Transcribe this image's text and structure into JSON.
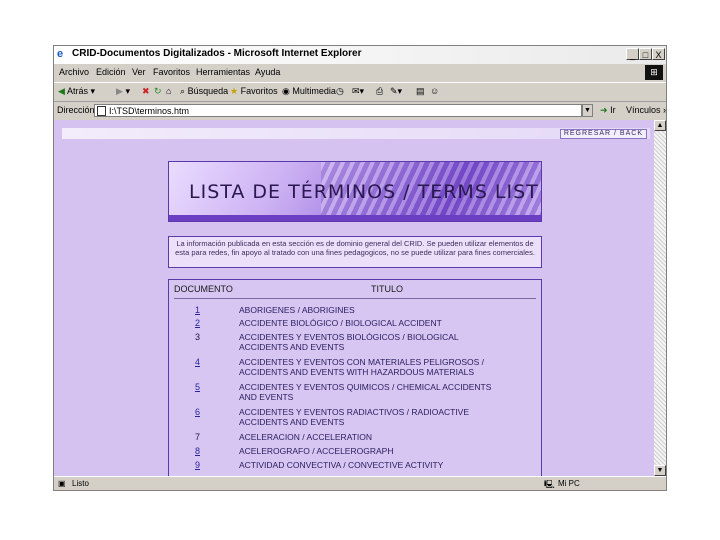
{
  "window": {
    "title": "CRID-Documentos Digitalizados - Microsoft Internet Explorer",
    "controls": [
      "_",
      "□",
      "X"
    ]
  },
  "menu": [
    "Archivo",
    "Edición",
    "Ver",
    "Favoritos",
    "Herramientas",
    "Ayuda"
  ],
  "toolbar": {
    "back": "Atrás",
    "search": "Búsqueda",
    "favorites": "Favoritos",
    "multimedia": "Multimedia"
  },
  "address": {
    "label": "Dirección",
    "value": "I:\\TSD\\terminos.htm",
    "go": "Ir",
    "links": "Vínculos"
  },
  "page": {
    "regresar": "REGRESAR / BACK",
    "banner_title": "LISTA DE TÉRMINOS / TERMS LIST",
    "intro": "La información publicada en esta sección es de dominio general del CRID. Se pueden utilizar elementos de esta para redes, fin apoyo al tratado con una fines pedagogicos, no se puede utilizar para fines comerciales.",
    "table": {
      "col_doc": "DOCUMENTO",
      "col_title": "TITULO",
      "rows": [
        {
          "num": "1",
          "link": true,
          "title": "ABORIGENES / ABORIGINES"
        },
        {
          "num": "2",
          "link": true,
          "title": "ACCIDENTE BIOLÓGICO / BIOLOGICAL ACCIDENT"
        },
        {
          "num": "3",
          "link": false,
          "title": "ACCIDENTES Y EVENTOS BIOLÓGICOS / BIOLOGICAL",
          "title2": "ACCIDENTS AND EVENTS"
        },
        {
          "num": "4",
          "link": true,
          "title": "ACCIDENTES Y EVENTOS CON MATERIALES PELIGROSOS /",
          "title2": "ACCIDENTS AND EVENTS WITH HAZARDOUS MATERIALS"
        },
        {
          "num": "5",
          "link": true,
          "title": "ACCIDENTES Y EVENTOS QUIMICOS / CHEMICAL ACCIDENTS",
          "title2": "AND EVENTS"
        },
        {
          "num": "6",
          "link": true,
          "title": "ACCIDENTES Y EVENTOS RADIACTIVOS / RADIOACTIVE",
          "title2": "ACCIDENTS AND EVENTS"
        },
        {
          "num": "7",
          "link": false,
          "title": "ACELERACION / ACCELERATION"
        },
        {
          "num": "8",
          "link": true,
          "title": "ACELEROGRAFO / ACCELEROGRAPH"
        },
        {
          "num": "9",
          "link": true,
          "title": "ACTIVIDAD CONVECTIVA / CONVECTIVE ACTIVITY"
        }
      ]
    }
  },
  "status": {
    "left": "Listo",
    "right": "Mi PC"
  }
}
